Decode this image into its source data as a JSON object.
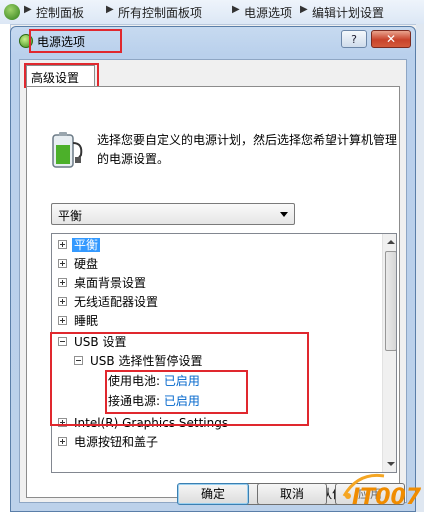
{
  "explorer": {
    "breadcrumbs": [
      "控制面板",
      "所有控制面板项",
      "电源选项",
      "编辑计划设置"
    ]
  },
  "dialog": {
    "title": "电源选项",
    "help_label": "?",
    "close_label": "✕",
    "tab_label": "高级设置",
    "description": "选择您要自定义的电源计划，然后选择您希望计算机管理的电源设置。",
    "plan_select": {
      "value": "平衡"
    },
    "tree": [
      {
        "label": "平衡",
        "expander": "plus",
        "selected": true
      },
      {
        "label": "硬盘",
        "expander": "plus"
      },
      {
        "label": "桌面背景设置",
        "expander": "plus"
      },
      {
        "label": "无线适配器设置",
        "expander": "plus"
      },
      {
        "label": "睡眠",
        "expander": "plus"
      },
      {
        "label": "USB 设置",
        "expander": "minus"
      },
      {
        "label": "USB 选择性暂停设置",
        "expander": "minus"
      },
      {
        "label": "使用电池:",
        "value": "已启用"
      },
      {
        "label": "接通电源:",
        "value": "已启用"
      },
      {
        "label": "Intel(R) Graphics Settings",
        "expander": "plus"
      },
      {
        "label": "电源按钮和盖子",
        "expander": "plus"
      }
    ],
    "restore_button": "还原计划默认值(R)",
    "ok_button": "确定",
    "cancel_button": "取消",
    "apply_button": "应用"
  },
  "watermark": {
    "text": "IT007"
  },
  "colors": {
    "highlight": "#e0282e",
    "selection": "#3399ff",
    "link": "#0066cc"
  }
}
